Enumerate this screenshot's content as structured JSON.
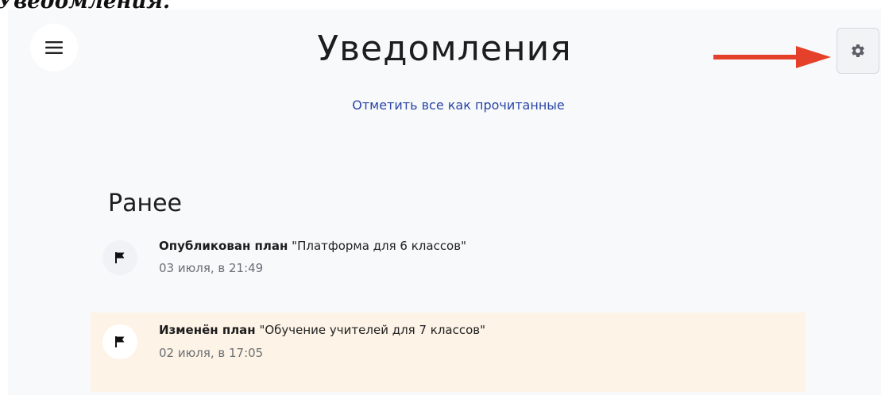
{
  "top_cut_text": "Уведомления.",
  "header": {
    "title": "Уведомления",
    "menu_icon": "hamburger-menu-icon",
    "settings_icon": "gear-icon"
  },
  "actions": {
    "mark_all_read": "Отметить все как прочитанные"
  },
  "section": {
    "title": "Ранее",
    "notifications": [
      {
        "icon": "flag-icon",
        "action": "Опубликован план",
        "object": "\"Платформа для 6 классов\"",
        "time": "03 июля, в 21:49",
        "highlighted": false
      },
      {
        "icon": "flag-icon",
        "action": "Изменён план",
        "object": "\"Обучение учителей для 7 классов\"",
        "time": "02 июля, в 17:05",
        "highlighted": true
      }
    ]
  },
  "colors": {
    "link": "#2a46a6",
    "highlight_bg": "#fdf3e6",
    "arrow": "#e5412a",
    "background": "#f7f9fb"
  }
}
